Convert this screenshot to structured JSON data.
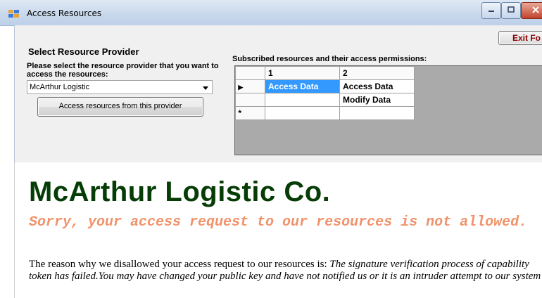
{
  "window": {
    "title": "Access Resources",
    "icon": "app-window-icon",
    "controls": [
      "minimize-icon",
      "maximize-icon",
      "close-icon"
    ]
  },
  "toolbar": {
    "exit_label": "Exit Fo"
  },
  "provider_group": {
    "title": "Select Resource Provider",
    "prompt": "Please select the resource provider that you want to access the resources:",
    "selected_provider": "McArthur Logistic",
    "access_button_label": "Access resources from this provider"
  },
  "permissions": {
    "label": "Subscribed resources and their access permissions:",
    "columns": [
      "1",
      "2"
    ],
    "rows": [
      {
        "marker": "▶",
        "cells": [
          "Access Data",
          "Access Data"
        ]
      },
      {
        "marker": "",
        "cells": [
          "",
          "Modify Data"
        ]
      },
      {
        "marker": "*",
        "cells": [
          "",
          ""
        ]
      }
    ]
  },
  "page": {
    "company": "McArthur Logistic Co.",
    "sorry": "Sorry, your access request to our resources is not allowed.",
    "reason_prefix": "The reason why we disallowed your access request to our resources is: ",
    "reason_message": "The signature verification process of capability token has failed.You may have changed your public key and have not notified us or it is an intruder attempt to our system"
  },
  "colors": {
    "company": "#063d06",
    "sorry": "#f0926a",
    "selection": "#3399ff",
    "exit_text": "#8b0000"
  }
}
